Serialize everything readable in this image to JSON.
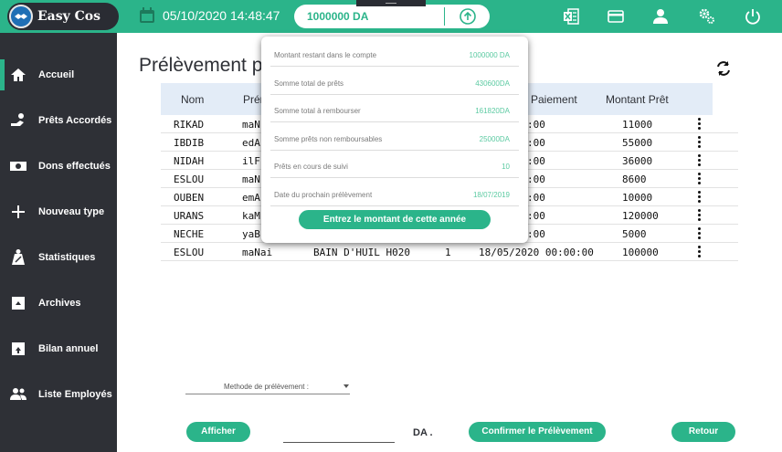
{
  "app": {
    "logo_text": "Easy Cos",
    "datetime": "05/10/2020 14:48:47",
    "balance": "1000000 DA"
  },
  "colors": {
    "accent": "#2bb48a",
    "sidebar": "#2e3036",
    "table_header": "#e3ecf7"
  },
  "top_icons": [
    "excel-icon",
    "card-icon",
    "user-icon",
    "settings-icon",
    "power-icon"
  ],
  "sidebar": {
    "items": [
      {
        "label": "Accueil",
        "icon": "home-icon",
        "active": true
      },
      {
        "label": "Prêts Accordés",
        "icon": "loan-icon",
        "active": false
      },
      {
        "label": "Dons effectués",
        "icon": "money-icon",
        "active": false
      },
      {
        "label": "Nouveau type",
        "icon": "plus-icon",
        "active": false
      },
      {
        "label": "Statistiques",
        "icon": "stats-icon",
        "active": false
      },
      {
        "label": "Archives",
        "icon": "archive-icon",
        "active": false
      },
      {
        "label": "Bilan annuel",
        "icon": "upload-icon",
        "active": false
      },
      {
        "label": "Liste Employés",
        "icon": "people-icon",
        "active": false
      }
    ]
  },
  "main": {
    "title": "Prélèvement p",
    "table": {
      "headers": {
        "nom": "Nom",
        "prenom": "Prén",
        "paiement": "Paiement",
        "montant": "Montant Prêt"
      },
      "rows": [
        {
          "nom": "RIKAD",
          "prenom": "maN",
          "type": "",
          "n": "",
          "date": "20 00:00:00",
          "montant": "11000"
        },
        {
          "nom": "IBDIB",
          "prenom": "edA",
          "type": "",
          "n": "",
          "date": "20 00:00:00",
          "montant": "55000"
        },
        {
          "nom": "NIDAH",
          "prenom": "ilF",
          "type": "",
          "n": "",
          "date": "20 00:00:00",
          "montant": "36000"
        },
        {
          "nom": "ESLOU",
          "prenom": "maN",
          "type": "",
          "n": "",
          "date": "20 00:00:00",
          "montant": "8600"
        },
        {
          "nom": "OUBEN",
          "prenom": "emA",
          "type": "",
          "n": "",
          "date": "20 00:00:00",
          "montant": "10000"
        },
        {
          "nom": "URANS",
          "prenom": "kaM",
          "type": "",
          "n": "",
          "date": "20 00:00:00",
          "montant": "120000"
        },
        {
          "nom": "NECHE",
          "prenom": "yaB",
          "type": "",
          "n": "",
          "date": "20 00:00:00",
          "montant": "5000"
        },
        {
          "nom": "ESLOU",
          "prenom": "maNai",
          "type": "BAIN D'HUIL H020",
          "n": "1",
          "date": "18/05/2020 00:00:00",
          "montant": "100000"
        }
      ]
    }
  },
  "popover": {
    "rows": [
      {
        "label": "Montant restant dans le compte",
        "value": "1000000 DA"
      },
      {
        "label": "Somme total de prêts",
        "value": "430600DA"
      },
      {
        "label": "Somme total à rembourser",
        "value": "161820DA"
      },
      {
        "label": "Somme prêts non remboursables",
        "value": "25000DA"
      },
      {
        "label": "Prêts en cours de suivi",
        "value": "10"
      },
      {
        "label": "Date du prochain prélèvement",
        "value": "18/07/2019"
      }
    ],
    "button": "Entrez le montant de cette année"
  },
  "bottom": {
    "select_label": "Methode de prélèvement :",
    "afficher": "Afficher",
    "amount_value": "",
    "da": "DA .",
    "confirmer": "Confirmer le Prélèvement",
    "retour": "Retour"
  }
}
